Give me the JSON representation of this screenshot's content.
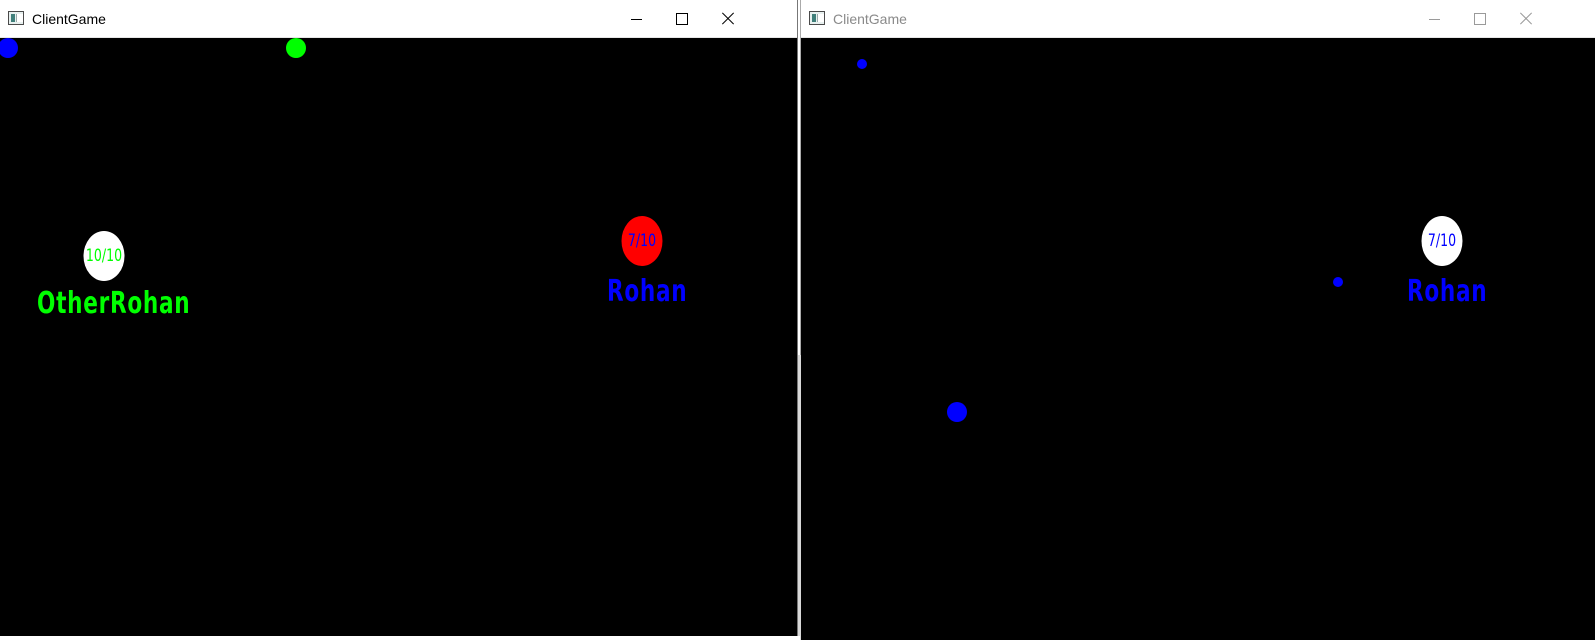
{
  "windows": [
    {
      "title": "ClientGame",
      "players": [
        {
          "health": "10/10",
          "name": "OtherRohan",
          "circle_color": "#ffffff",
          "text_color": "#00ff00"
        },
        {
          "health": "7/10",
          "name": "Rohan",
          "circle_color": "#ff0000",
          "text_color": "#0000ff"
        }
      ]
    },
    {
      "title": "ClientGame",
      "players": [
        {
          "health": "7/10",
          "name": "Rohan",
          "circle_color": "#ffffff",
          "text_color": "#0000ff"
        }
      ]
    }
  ],
  "colors": {
    "blue": "#0000ff",
    "green": "#00ff00",
    "red": "#ff0000",
    "background": "#000000"
  }
}
